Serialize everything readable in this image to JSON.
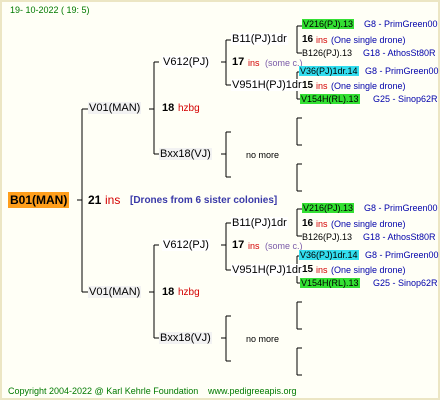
{
  "header": {
    "date": "19- 10-2022 ( 19: 5)"
  },
  "footer": {
    "copyright": "Copyright 2004-2022 @ Karl Kehrle Foundation",
    "site": "www.pedigreeapis.org"
  },
  "root": {
    "label": "B01(MAN)",
    "count": "21",
    "ins": "ins",
    "note": "[Drones from 6 sister colonies]"
  },
  "top": {
    "parent": {
      "label": "V01(MAN)",
      "count": "18",
      "tag": "hzbg"
    },
    "queen": {
      "label": "V612(PJ)",
      "count": "17",
      "ins": "ins",
      "note": "(some c.)"
    },
    "gq": {
      "label": "B11(PJ)1dr",
      "count": "16",
      "ins": "ins",
      "note": "(One single drone)",
      "c1": {
        "label": "V216(PJ).13",
        "ref": "G8 - PrimGreen00"
      },
      "c2": {
        "label": "B126(PJ).13",
        "ref": "G18 - AthosSt80R"
      }
    },
    "gd": {
      "label": "V951H(PJ)1dr",
      "count": "15",
      "ins": "ins",
      "note": "(One single drone)",
      "c1": {
        "label": "V36(PJ)1dr.14",
        "ref": "G8 - PrimGreen00"
      },
      "c2": {
        "label": "V154H(RL).13",
        "ref": "G25 - Sinop62R"
      }
    },
    "drone": {
      "label": "Bxx18(VJ)",
      "more": "no more"
    }
  },
  "bottom": {
    "parent": {
      "label": "V01(MAN)",
      "count": "18",
      "tag": "hzbg"
    },
    "queen": {
      "label": "V612(PJ)",
      "count": "17",
      "ins": "ins",
      "note": "(some c.)"
    },
    "gq": {
      "label": "B11(PJ)1dr",
      "count": "16",
      "ins": "ins",
      "note": "(One single drone)",
      "c1": {
        "label": "V216(PJ).13",
        "ref": "G8 - PrimGreen00"
      },
      "c2": {
        "label": "B126(PJ).13",
        "ref": "G18 - AthosSt80R"
      }
    },
    "gd": {
      "label": "V951H(PJ)1dr",
      "count": "15",
      "ins": "ins",
      "note": "(One single drone)",
      "c1": {
        "label": "V36(PJ)1dr.14",
        "ref": "G8 - PrimGreen00"
      },
      "c2": {
        "label": "V154H(RL).13",
        "ref": "G25 - Sinop62R"
      }
    },
    "drone": {
      "label": "Bxx18(VJ)",
      "more": "no more"
    }
  },
  "colors": {
    "root_bg": "#ff9e1b",
    "green": "#33e033",
    "cyan": "#33ddee",
    "ins": "#d40000",
    "ref": "#0000aa"
  }
}
